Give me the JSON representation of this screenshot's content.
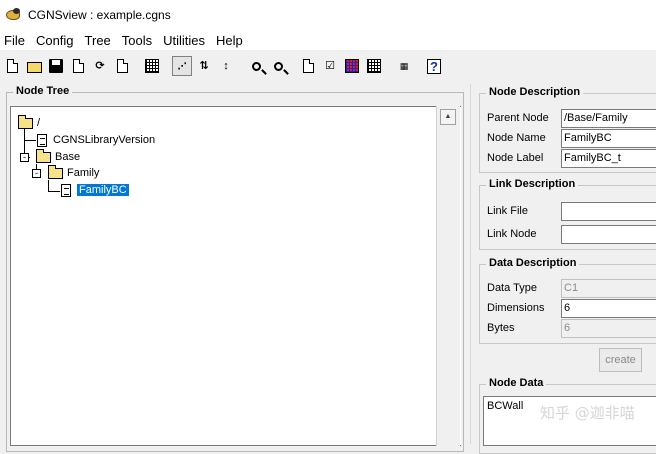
{
  "window": {
    "title": "CGNSview : example.cgns"
  },
  "menu": [
    "File",
    "Config",
    "Tree",
    "Tools",
    "Utilities",
    "Help"
  ],
  "toolbar": {
    "buttons": [
      {
        "name": "new-file-button",
        "icon": "new-document-icon"
      },
      {
        "name": "open-file-button",
        "icon": "open-folder-icon"
      },
      {
        "name": "save-file-button",
        "icon": "floppy-disk-icon"
      },
      {
        "name": "save-as-button",
        "icon": "save-as-icon"
      },
      {
        "name": "reload-button",
        "icon": "reload-icon"
      },
      {
        "name": "file-info-button",
        "icon": "file-info-icon"
      },
      {
        "name": "node-list-button",
        "icon": "find-node-icon"
      },
      {
        "name": "tree-view-button",
        "icon": "tree-view-icon"
      },
      {
        "name": "sort-tree-button",
        "icon": "sort-tree-icon"
      },
      {
        "name": "move-node-button",
        "icon": "move-node-icon"
      },
      {
        "name": "find-button",
        "icon": "magnifier-icon"
      },
      {
        "name": "find-next-button",
        "icon": "magnifier-next-icon"
      },
      {
        "name": "copy-node-button",
        "icon": "copy-icon"
      },
      {
        "name": "check-file-button",
        "icon": "checklist-icon"
      },
      {
        "name": "plot-button",
        "icon": "plot-grid-icon"
      },
      {
        "name": "edit-table-button",
        "icon": "table-icon"
      },
      {
        "name": "units-button",
        "icon": "units-icon"
      },
      {
        "name": "help-button",
        "icon": "question-mark-icon"
      }
    ]
  },
  "node_tree": {
    "title": "Node Tree",
    "nodes": [
      {
        "label": "/",
        "type": "folder",
        "level": 0
      },
      {
        "label": "CGNSLibraryVersion",
        "type": "data",
        "level": 1
      },
      {
        "label": "Base",
        "type": "folder",
        "level": 1
      },
      {
        "label": "Family",
        "type": "folder",
        "level": 2
      },
      {
        "label": "FamilyBC",
        "type": "data",
        "level": 3,
        "selected": true
      }
    ]
  },
  "node_description": {
    "title": "Node Description",
    "parent_node_label": "Parent Node",
    "parent_node_value": "/Base/Family",
    "node_name_label": "Node Name",
    "node_name_value": "FamilyBC",
    "node_label_label": "Node Label",
    "node_label_value": "FamilyBC_t"
  },
  "link_description": {
    "title": "Link Description",
    "link_file_label": "Link File",
    "link_file_value": "",
    "link_node_label": "Link Node",
    "link_node_value": ""
  },
  "data_description": {
    "title": "Data Description",
    "data_type_label": "Data Type",
    "data_type_value": "C1",
    "dimensions_label": "Dimensions",
    "dimensions_value": "6",
    "bytes_label": "Bytes",
    "bytes_value": "6",
    "create_label": "create"
  },
  "node_data": {
    "title": "Node Data",
    "value": "BCWall"
  },
  "watermark": "知乎 @迦非喵",
  "colors": {
    "selection": "#0078d7",
    "folder": "#f5e28a"
  }
}
